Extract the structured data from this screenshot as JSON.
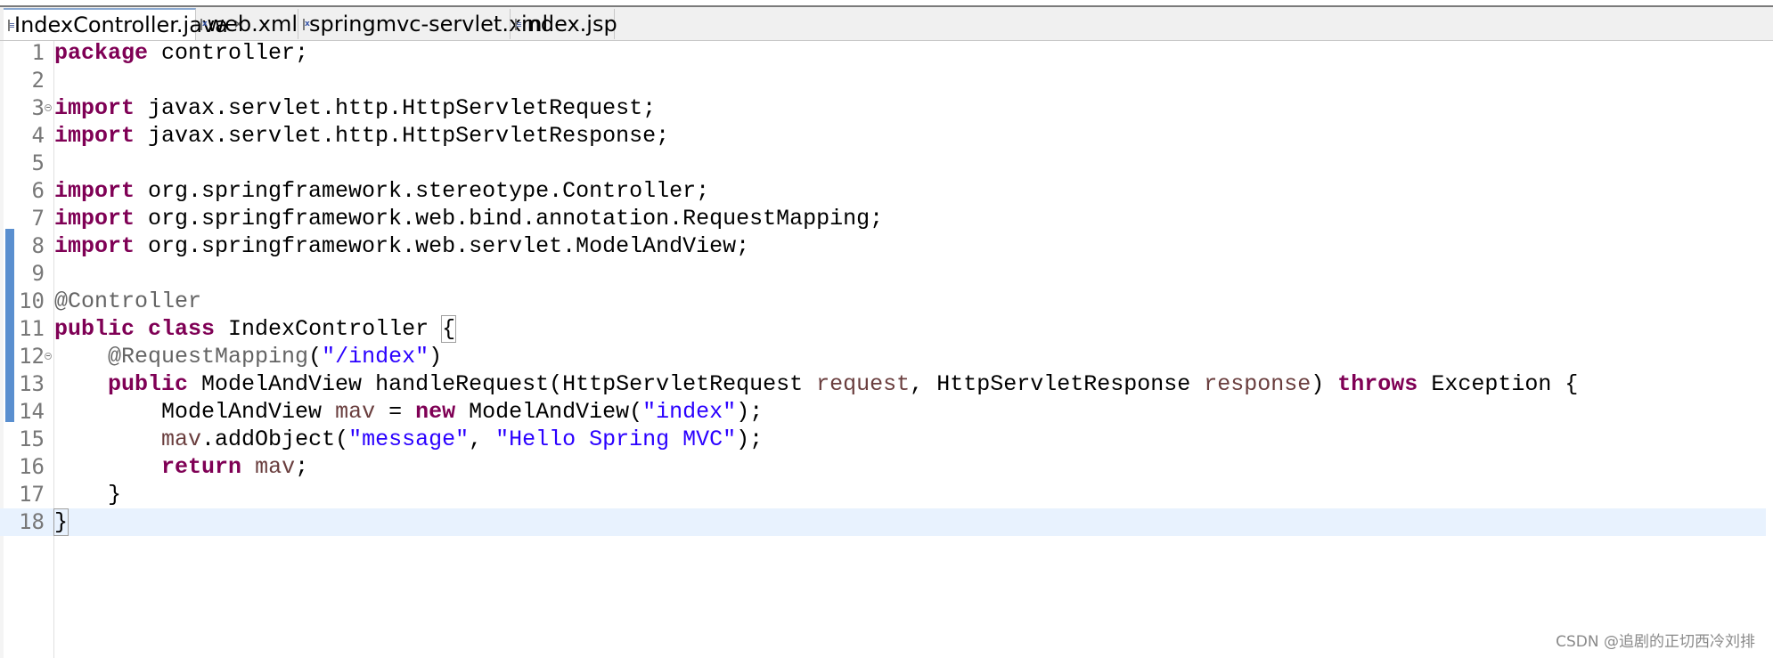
{
  "tabs": [
    {
      "label": "IndexController.java",
      "icon": "java-file-icon",
      "active": true,
      "closable": true
    },
    {
      "label": "web.xml",
      "icon": "xml-file-icon",
      "active": false
    },
    {
      "label": "springmvc-servlet.xml",
      "icon": "xml-file-icon",
      "active": false
    },
    {
      "label": "index.jsp",
      "icon": "jsp-file-icon",
      "active": false
    }
  ],
  "close_glyph": "✕",
  "editor": {
    "current_line": 18,
    "lines": [
      {
        "n": "1",
        "tokens": [
          {
            "t": "package",
            "c": "kw"
          },
          {
            "t": " controller;",
            "c": ""
          }
        ]
      },
      {
        "n": "2",
        "tokens": []
      },
      {
        "n": "3",
        "fold": true,
        "tokens": [
          {
            "t": "import",
            "c": "kw"
          },
          {
            "t": " javax.servlet.http.HttpServletRequest;",
            "c": ""
          }
        ]
      },
      {
        "n": "4",
        "tokens": [
          {
            "t": "import",
            "c": "kw"
          },
          {
            "t": " javax.servlet.http.HttpServletResponse;",
            "c": ""
          }
        ]
      },
      {
        "n": "5",
        "tokens": []
      },
      {
        "n": "6",
        "tokens": [
          {
            "t": "import",
            "c": "kw"
          },
          {
            "t": " org.springframework.stereotype.Controller;",
            "c": ""
          }
        ]
      },
      {
        "n": "7",
        "tokens": [
          {
            "t": "import",
            "c": "kw"
          },
          {
            "t": " org.springframework.web.bind.annotation.RequestMapping;",
            "c": ""
          }
        ]
      },
      {
        "n": "8",
        "tokens": [
          {
            "t": "import",
            "c": "kw"
          },
          {
            "t": " org.springframework.web.servlet.ModelAndView;",
            "c": ""
          }
        ]
      },
      {
        "n": "9",
        "tokens": []
      },
      {
        "n": "10",
        "tokens": [
          {
            "t": "@Controller",
            "c": "ann"
          }
        ]
      },
      {
        "n": "11",
        "tokens": [
          {
            "t": "public",
            "c": "kw"
          },
          {
            "t": " ",
            "c": ""
          },
          {
            "t": "class",
            "c": "kw"
          },
          {
            "t": " IndexController ",
            "c": ""
          },
          {
            "t": "{",
            "c": "bracket-box"
          }
        ]
      },
      {
        "n": "12",
        "fold": true,
        "tokens": [
          {
            "t": "    ",
            "c": ""
          },
          {
            "t": "@RequestMapping",
            "c": "ann"
          },
          {
            "t": "(",
            "c": ""
          },
          {
            "t": "\"/index\"",
            "c": "str"
          },
          {
            "t": ")",
            "c": ""
          }
        ]
      },
      {
        "n": "13",
        "tokens": [
          {
            "t": "    ",
            "c": ""
          },
          {
            "t": "public",
            "c": "kw"
          },
          {
            "t": " ModelAndView handleRequest(HttpServletRequest ",
            "c": ""
          },
          {
            "t": "request",
            "c": "var"
          },
          {
            "t": ", HttpServletResponse ",
            "c": ""
          },
          {
            "t": "response",
            "c": "var"
          },
          {
            "t": ") ",
            "c": ""
          },
          {
            "t": "throws",
            "c": "kw"
          },
          {
            "t": " Exception {",
            "c": ""
          }
        ]
      },
      {
        "n": "14",
        "tokens": [
          {
            "t": "        ModelAndView ",
            "c": ""
          },
          {
            "t": "mav",
            "c": "var"
          },
          {
            "t": " = ",
            "c": ""
          },
          {
            "t": "new",
            "c": "kw"
          },
          {
            "t": " ModelAndView(",
            "c": ""
          },
          {
            "t": "\"index\"",
            "c": "str"
          },
          {
            "t": ");",
            "c": ""
          }
        ]
      },
      {
        "n": "15",
        "tokens": [
          {
            "t": "        ",
            "c": ""
          },
          {
            "t": "mav",
            "c": "var"
          },
          {
            "t": ".addObject(",
            "c": ""
          },
          {
            "t": "\"message\"",
            "c": "str"
          },
          {
            "t": ", ",
            "c": ""
          },
          {
            "t": "\"Hello Spring MVC\"",
            "c": "str"
          },
          {
            "t": ");",
            "c": ""
          }
        ]
      },
      {
        "n": "16",
        "tokens": [
          {
            "t": "        ",
            "c": ""
          },
          {
            "t": "return",
            "c": "kw"
          },
          {
            "t": " ",
            "c": ""
          },
          {
            "t": "mav",
            "c": "var"
          },
          {
            "t": ";",
            "c": ""
          }
        ]
      },
      {
        "n": "17",
        "tokens": [
          {
            "t": "    }",
            "c": ""
          }
        ]
      },
      {
        "n": "18",
        "tokens": [
          {
            "t": "}",
            "c": "bracket-box"
          }
        ]
      }
    ]
  },
  "watermark": "CSDN @追剧的正切西冷刘排",
  "colors": {
    "keyword": "#7f0055",
    "string": "#2a00ff",
    "annotation": "#646464",
    "local_variable": "#6a3e3e",
    "line_number": "#787878",
    "current_line_bg": "#e8f2fe",
    "change_bar": "#5a8fcf"
  }
}
